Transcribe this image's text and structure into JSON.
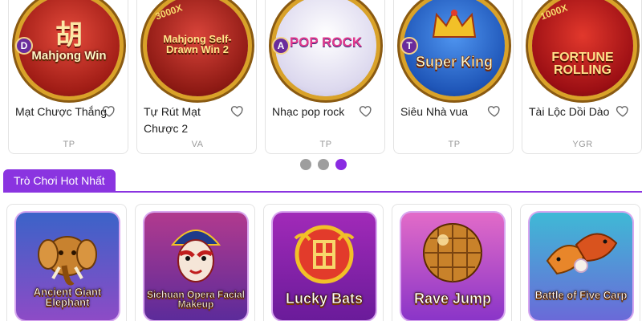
{
  "carousel": {
    "cards": [
      {
        "title": "Mạt Chược Thắng",
        "provider": "TP",
        "art_text": "Mahjong Win",
        "art_top": "胡",
        "badge": "D",
        "bg": "#c9342b"
      },
      {
        "title": "Tự Rút Mạt Chược 2",
        "provider": "VA",
        "art_text": "Mahjong Self-Drawn Win 2",
        "art_top": "3000X",
        "badge": "",
        "bg": "#b5261e"
      },
      {
        "title": "Nhạc pop rock",
        "provider": "TP",
        "art_text": "POP ROCK",
        "art_top": "",
        "badge": "A",
        "bg": "#e8e6f4"
      },
      {
        "title": "Siêu Nhà vua",
        "provider": "TP",
        "art_text": "Super King",
        "art_top": "",
        "badge": "T",
        "bg": "#2f70d6"
      },
      {
        "title": "Tài Lộc Dồi Dào",
        "provider": "YGR",
        "art_text": "FORTUNE ROLLING",
        "art_top": "1000X",
        "badge": "",
        "bg": "#b8121a"
      }
    ],
    "dots": [
      {
        "active": false
      },
      {
        "active": false
      },
      {
        "active": true
      }
    ]
  },
  "section": {
    "title": "Trò Chơi Hot Nhất"
  },
  "hot_games": [
    {
      "art_text": "Ancient Giant Elephant",
      "bg_top": "#3b63c8",
      "bg_bottom": "#8d4bc6"
    },
    {
      "art_text": "Sichuan Opera Facial Makeup",
      "bg_top": "#b13a8e",
      "bg_bottom": "#5c2b9a"
    },
    {
      "art_text": "Lucky Bats",
      "bg_top": "#a12ab8",
      "bg_bottom": "#6a1b9a"
    },
    {
      "art_text": "Rave Jump",
      "bg_top": "#e26bc8",
      "bg_bottom": "#8a35c8"
    },
    {
      "art_text": "Battle of Five Carp",
      "bg_top": "#3fb9d6",
      "bg_bottom": "#6a6ad8"
    }
  ],
  "colors": {
    "accent": "#8a34e0",
    "dot_inactive": "#9e9e9e",
    "provider_text": "#9a9a9a"
  }
}
